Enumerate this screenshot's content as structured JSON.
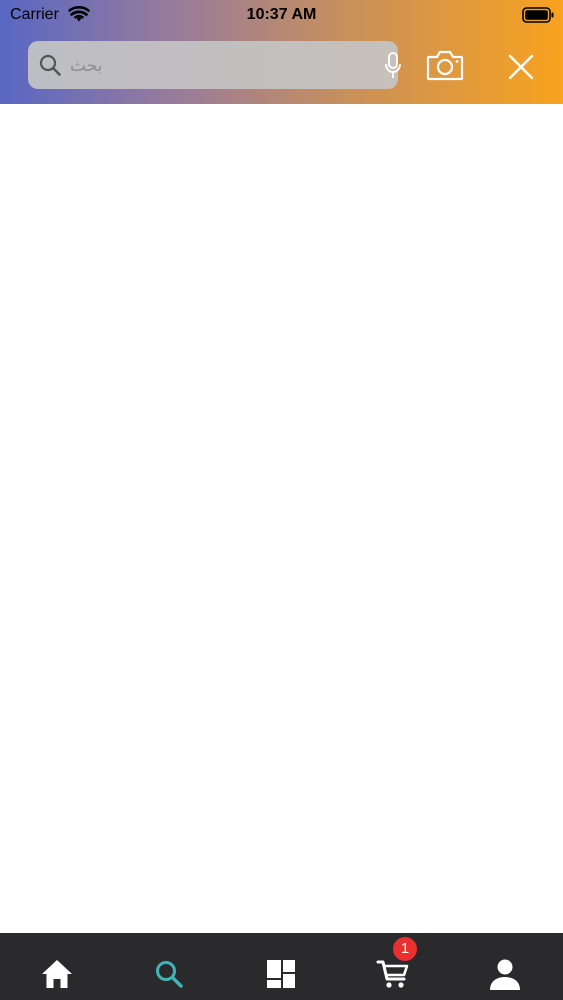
{
  "status_bar": {
    "carrier": "Carrier",
    "time": "10:37 AM"
  },
  "search": {
    "placeholder": "بحث",
    "value": ""
  },
  "icons": {
    "wifi": "wifi-icon",
    "battery": "battery-icon",
    "search": "search-icon",
    "mic": "microphone-icon",
    "camera": "camera-icon",
    "close": "close-icon"
  },
  "colors": {
    "header_gradient_start": "#5867c4",
    "header_gradient_end": "#f8a21e",
    "tab_bar_bg": "#2a2a2c",
    "tab_active": "#3fb5b8",
    "tab_inactive": "#ffffff",
    "badge": "#e9302e"
  },
  "tab_bar": {
    "tabs": [
      {
        "name": "home",
        "icon": "home-icon",
        "active": false
      },
      {
        "name": "search",
        "icon": "search-icon",
        "active": true
      },
      {
        "name": "categories",
        "icon": "categories-icon",
        "active": false
      },
      {
        "name": "cart",
        "icon": "cart-icon",
        "active": false
      },
      {
        "name": "profile",
        "icon": "profile-icon",
        "active": false
      }
    ],
    "cart_badge": "1"
  }
}
